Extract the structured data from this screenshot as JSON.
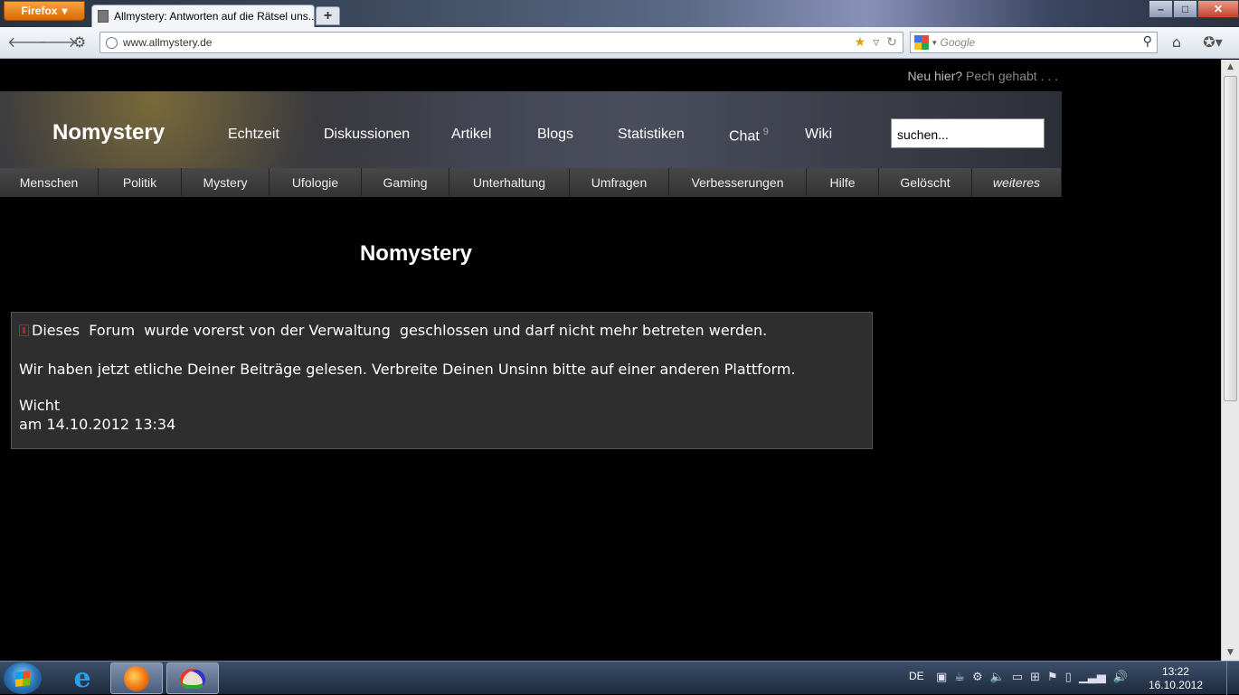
{
  "browser": {
    "menu_button": "Firefox",
    "tab_title": "Allmystery: Antworten auf die Rätsel uns...",
    "new_tab": "+",
    "url": "www.allmystery.de",
    "search_placeholder": "Google",
    "window_controls": {
      "minimize": "–",
      "maximize": "□",
      "close": "✕"
    }
  },
  "site": {
    "top_right": {
      "prefix": "Neu hier?",
      "link": "Pech gehabt . . ."
    },
    "logo": "Nomystery",
    "main_nav": [
      {
        "label": "Echtzeit"
      },
      {
        "label": "Diskussionen"
      },
      {
        "label": "Artikel"
      },
      {
        "label": "Blogs"
      },
      {
        "label": "Statistiken"
      },
      {
        "label": "Chat",
        "badge": "9"
      },
      {
        "label": "Wiki"
      }
    ],
    "search_value": "suchen...",
    "categories": [
      "Menschen",
      "Politik",
      "Mystery",
      "Ufologie",
      "Gaming",
      "Unterhaltung",
      "Umfragen",
      "Verbesserungen",
      "Hilfe",
      "Gelöscht",
      "weiteres"
    ],
    "page_title": "Nomystery",
    "notice": {
      "line1": "Dieses  Forum  wurde vorerst von der Verwaltung  geschlossen und darf nicht mehr betreten werden.",
      "line2": "Wir haben jetzt etliche Deiner Beiträge gelesen. Verbreite Deinen Unsinn bitte auf einer anderen Plattform.",
      "author": "Wicht",
      "date": "am 14.10.2012 13:34"
    }
  },
  "taskbar": {
    "language": "DE",
    "time": "13:22",
    "date": "16.10.2012"
  }
}
